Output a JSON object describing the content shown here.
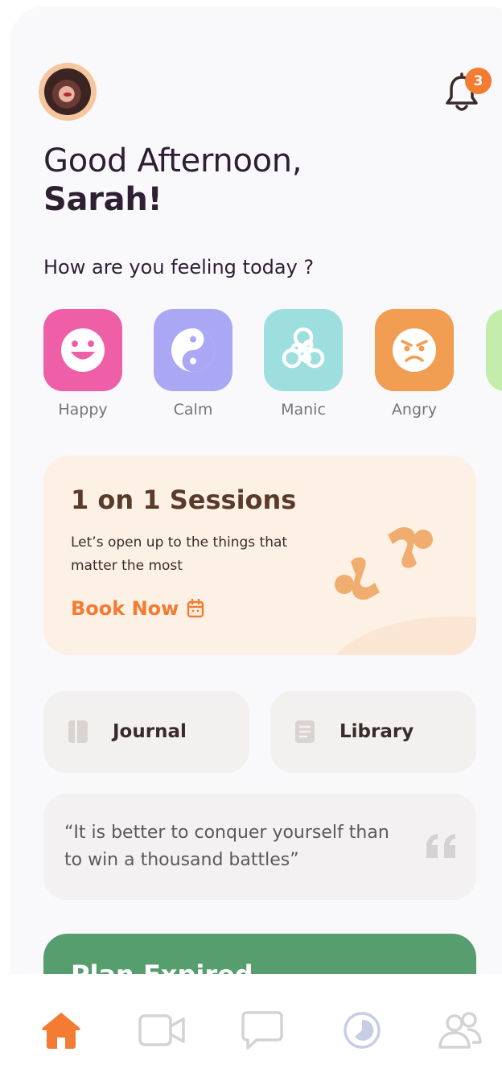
{
  "header": {
    "notifications_count": "3",
    "greeting_line1": "Good Afternoon,",
    "user_name": "Sarah!"
  },
  "mood_prompt": "How are you feeling today ?",
  "moods": [
    {
      "label": "Happy",
      "icon": "happy-face-icon",
      "color": "#ef5fa7"
    },
    {
      "label": "Calm",
      "icon": "yin-yang-icon",
      "color": "#aaa8f5"
    },
    {
      "label": "Manic",
      "icon": "triskelion-icon",
      "color": "#9ddfdf"
    },
    {
      "label": "Angry",
      "icon": "angry-face-icon",
      "color": "#f19d52"
    }
  ],
  "session_card": {
    "title": "1 on 1 Sessions",
    "description": "Let’s open up to the things that matter the most",
    "cta": "Book Now"
  },
  "quick_links": {
    "journal": "Journal",
    "library": "Library"
  },
  "quote": {
    "text": "“It is better to conquer yourself than to win a thousand battles”"
  },
  "plan_card": {
    "title": "Plan Expired"
  },
  "tabbar": {
    "items": [
      "home-icon",
      "video-icon",
      "chat-icon",
      "insights-icon",
      "community-icon"
    ],
    "active": "home-icon",
    "accent": "#f47b32"
  }
}
